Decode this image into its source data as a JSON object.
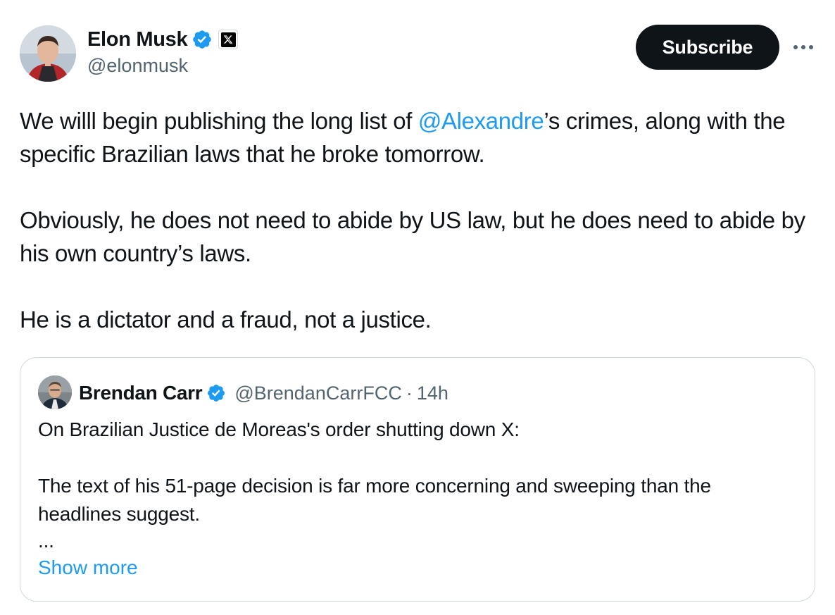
{
  "author": {
    "display_name": "Elon Musk",
    "handle": "@elonmusk",
    "avatar_icon": "avatar-photo",
    "verified_icon": "verified-badge-icon",
    "affiliate_icon": "x-logo-icon"
  },
  "actions": {
    "subscribe_label": "Subscribe",
    "more_icon": "more-horizontal-icon"
  },
  "tweet": {
    "line1_before": "We willl begin publishing the long list of ",
    "mention": "@Alexandre",
    "line1_after": "’s crimes, along with the specific Brazilian laws that he broke tomorrow.",
    "paragraph2": "Obviously, he does not need to abide by US law, but he does need to abide by his own country’s laws.",
    "paragraph3": "He is a dictator and a fraud, not a justice."
  },
  "quote": {
    "display_name": "Brendan Carr",
    "handle": "@BrendanCarrFCC",
    "separator": "·",
    "time": "14h",
    "paragraph1": "On Brazilian Justice de Moreas's order shutting down X:",
    "paragraph2": "The text of his 51-page decision is far more concerning and sweeping than the headlines suggest.",
    "ellipsis": "...",
    "show_more": "Show more"
  },
  "colors": {
    "text": "#0f1419",
    "secondary_text": "#536471",
    "link": "#1d9bf0",
    "verified": "#1d9bf0",
    "button_bg": "#0f1419",
    "border": "#cfd9de"
  }
}
